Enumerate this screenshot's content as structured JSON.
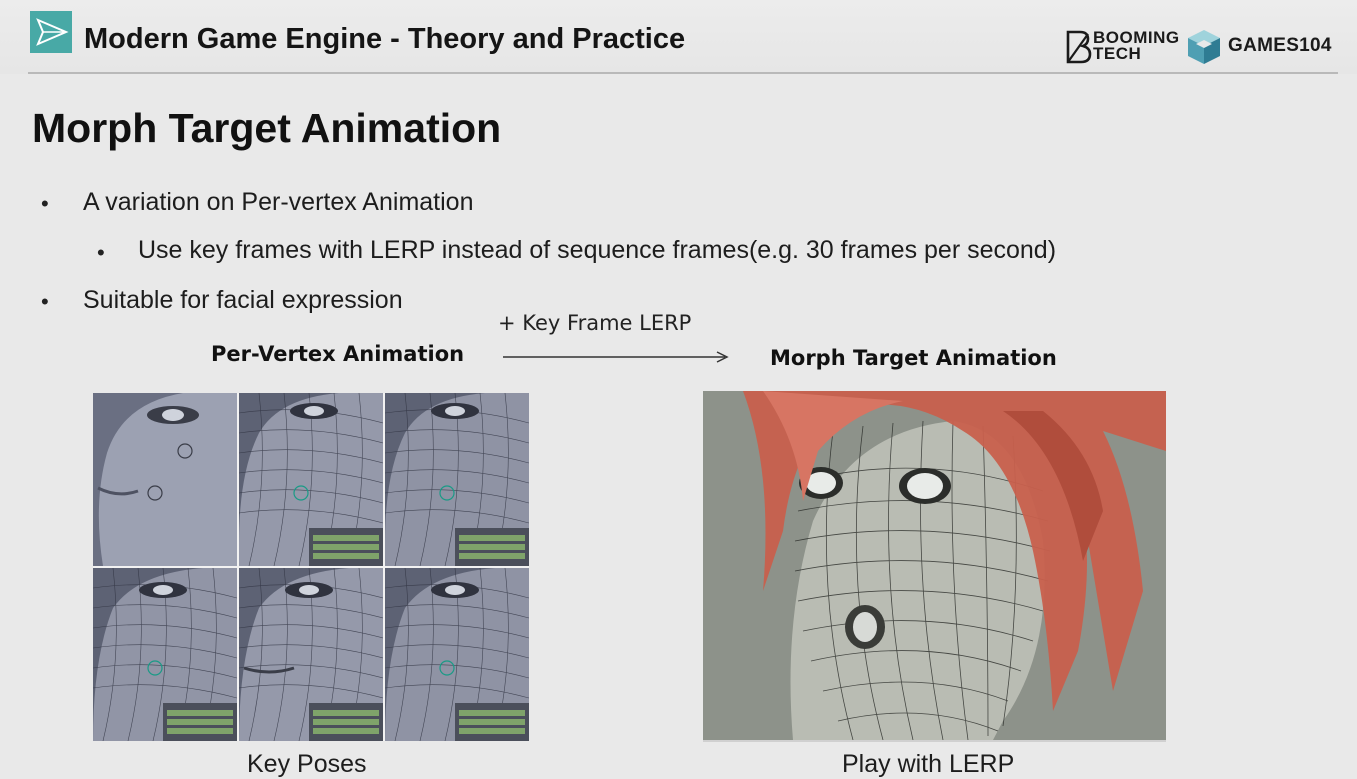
{
  "header": {
    "course_title": "Modern Game Engine - Theory and Practice",
    "booming_logo_text": "BOOMING\nTECH",
    "games_logo_text": "GAMES104",
    "accent_color": "#48a9a6"
  },
  "slide": {
    "title": "Morph Target Animation",
    "bullets": [
      {
        "level": 1,
        "text": "A variation on Per-vertex Animation"
      },
      {
        "level": 2,
        "text": "Use key frames with LERP instead of sequence frames(e.g. 30 frames per second)"
      },
      {
        "level": 1,
        "text": "Suitable for facial expression"
      }
    ]
  },
  "diagram": {
    "left_label": "Per-Vertex Animation",
    "arrow_label": "+ Key Frame LERP",
    "right_label": "Morph Target Animation",
    "left_caption": "Key Poses",
    "right_caption": "Play with LERP"
  },
  "icons": {
    "course_logo": "paper-plane-logo-icon",
    "booming_logo": "booming-tech-b-icon",
    "games_logo": "games104-cube-icon",
    "arrow": "right-arrow-icon"
  }
}
